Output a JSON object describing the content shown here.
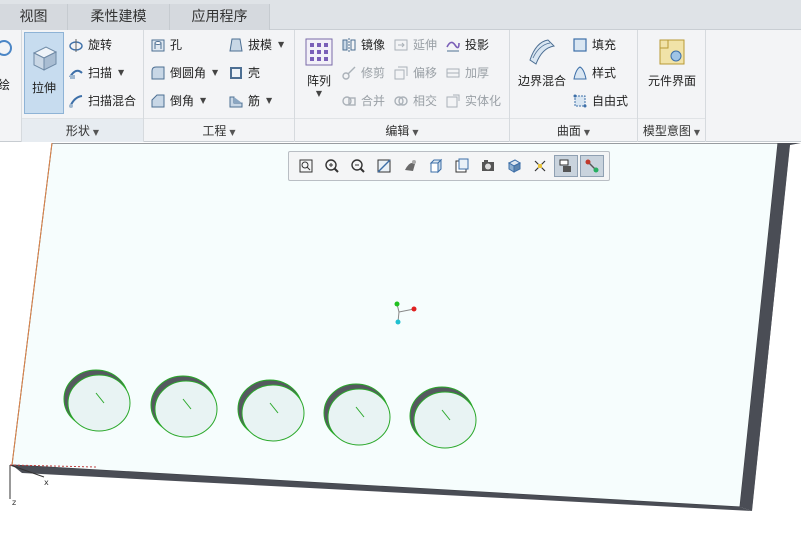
{
  "tabs": [
    {
      "label": "视图"
    },
    {
      "label": "柔性建模"
    },
    {
      "label": "应用程序"
    }
  ],
  "ribbon": {
    "partial_label": "绘",
    "shape_group": {
      "label": "形状",
      "extrude": "拉伸",
      "revolve": "旋转",
      "sweep": "扫描",
      "swept_blend": "扫描混合"
    },
    "engineering_group": {
      "label": "工程",
      "hole": "孔",
      "round": "倒圆角",
      "chamfer": "倒角",
      "draft": "拔模",
      "shell": "壳",
      "rib": "筋"
    },
    "editing_group": {
      "label": "编辑",
      "pattern": "阵列",
      "mirror": "镜像",
      "trim": "修剪",
      "merge": "合并",
      "extend": "延伸",
      "offset": "偏移",
      "intersect": "相交",
      "project": "投影",
      "thicken": "加厚",
      "solidify": "实体化"
    },
    "surfaces_group": {
      "label": "曲面",
      "boundary_blend": "边界混合",
      "fill": "填充",
      "style": "样式",
      "freestyle": "自由式"
    },
    "model_intent_group": {
      "label": "模型意图",
      "component_interface": "元件界面"
    }
  },
  "view_toolbar": {
    "icons": [
      "refit-icon",
      "zoom-in-icon",
      "zoom-out-icon",
      "repaint-icon",
      "display-style-icon",
      "saved-orientations-icon",
      "view-manager-icon",
      "perspective-icon",
      "section-icon",
      "datum-display-icon",
      "annotation-display-icon",
      "spin-center-icon"
    ]
  },
  "colors": {
    "accent": "#c7dcef",
    "plate_top": "#f6fdfd",
    "plate_side": "#4a4d55",
    "circle_edge": "#2aa82a",
    "csys_x": "#e02020",
    "csys_y": "#20c020",
    "csys_z": "#20c0d0"
  },
  "model": {
    "holes": 5
  }
}
